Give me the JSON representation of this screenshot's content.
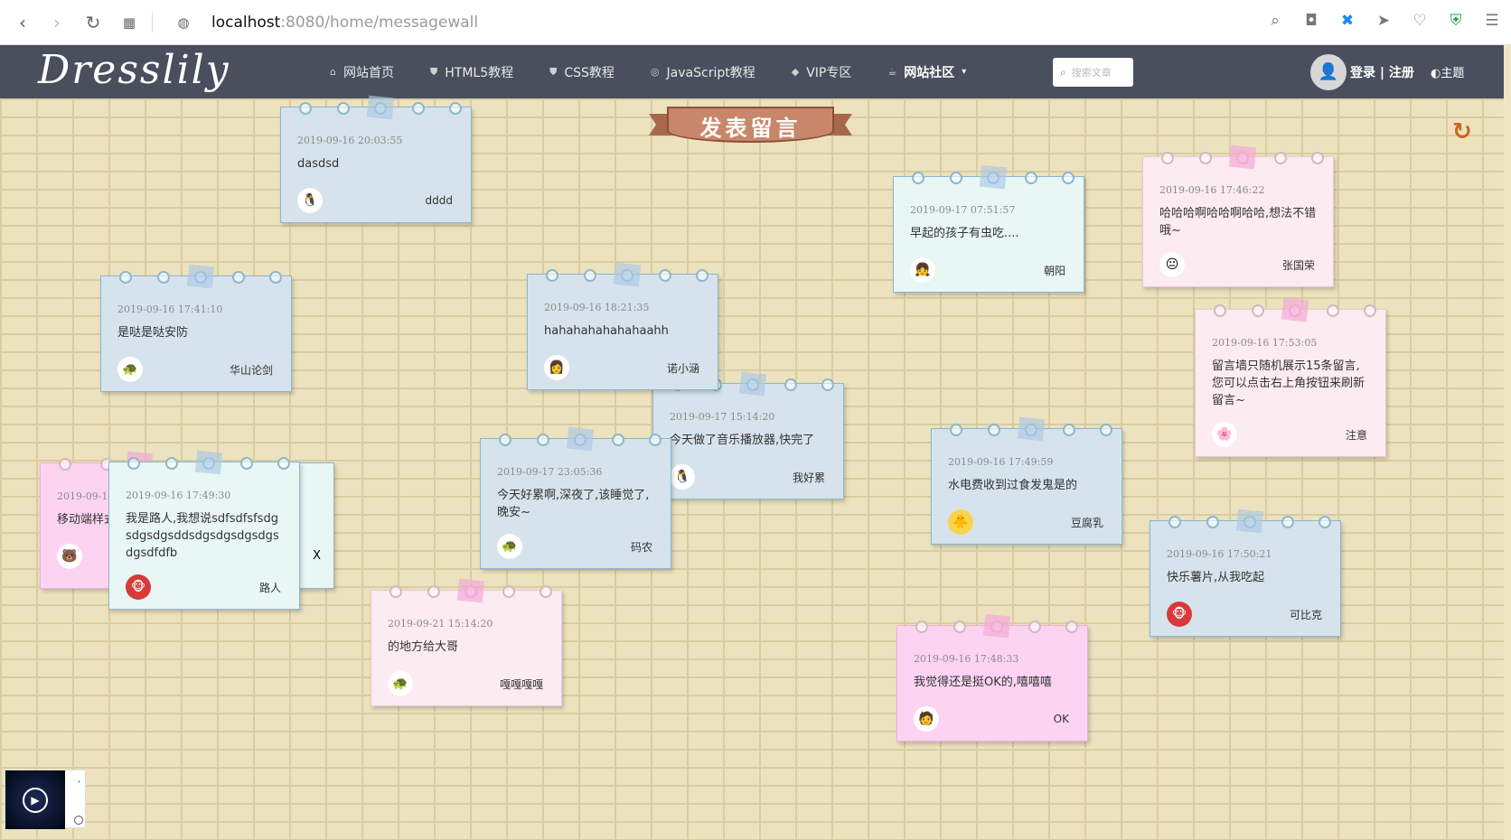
{
  "browser": {
    "url_host": "localhost",
    "url_path": ":8080/home/messagewall"
  },
  "header": {
    "logo": "Dresslily",
    "nav": [
      {
        "label": "网站首页",
        "icon": "home-icon"
      },
      {
        "label": "HTML5教程",
        "icon": "html5-icon"
      },
      {
        "label": "CSS教程",
        "icon": "css3-icon"
      },
      {
        "label": "JavaScript教程",
        "icon": "js-icon"
      },
      {
        "label": "VIP专区",
        "icon": "vip-icon"
      },
      {
        "label": "网站社区",
        "icon": "community-icon"
      }
    ],
    "search_placeholder": "搜索文章",
    "login": "登录 | 注册",
    "theme": "主题"
  },
  "wall": {
    "title": "发表留言"
  },
  "notes": [
    {
      "date": "2019-09-16 20:03:55",
      "message": "dasdsd",
      "author": "dddd"
    },
    {
      "date": "2019-09-16 17:41:10",
      "message": "是哒是哒安防",
      "author": "华山论剑"
    },
    {
      "date": "2019-09-16 18:21:35",
      "message": "hahahahahahahaahh",
      "author": "诺小涵"
    },
    {
      "date": "2019-09-17 15:14:20",
      "message": "今天做了音乐播放器,快完了",
      "author": "我好累"
    },
    {
      "date": "2019-09-17 23:05:36",
      "message": "今天好累啊,深夜了,该睡觉了,晚安~",
      "author": "码农"
    },
    {
      "date": "2019-09-17 07:51:57",
      "message": "早起的孩子有虫吃....",
      "author": "朝阳"
    },
    {
      "date": "2019-09-16 17:46:22",
      "message": "哈哈哈啊哈哈啊哈哈,想法不错哦~",
      "author": "张国荣"
    },
    {
      "date": "2019-09-16 17:53:05",
      "message": "留言墙只随机展示15条留言,您可以点击右上角按钮来刷新留言~",
      "author": "注意"
    },
    {
      "date": "2019-09-16 17:49:59",
      "message": "水电费收到过食发鬼是的",
      "author": "豆腐乳"
    },
    {
      "date": "2019-09-16 17:50:21",
      "message": "快乐薯片,从我吃起",
      "author": "可比克"
    },
    {
      "date": "2019-09-19",
      "message": "移动端样式",
      "author": ""
    },
    {
      "date": "2019-09-16 17:49:30",
      "message": "我是路人,我想说sdfsdfsfsdgsdgsdgsddsdgsdgsdgsdgsdgsdfdfb",
      "author": "路人"
    },
    {
      "date": "2019-09-21 15:14:20",
      "message": "的地方给大哥",
      "author": "嘎嘎嘎嘎"
    },
    {
      "date": "2019-09-16 17:48:33",
      "message": "我觉得还是挺OK的,嘻嘻嘻",
      "author": "OK"
    },
    {
      "date": "",
      "message": "",
      "author": "X"
    }
  ]
}
